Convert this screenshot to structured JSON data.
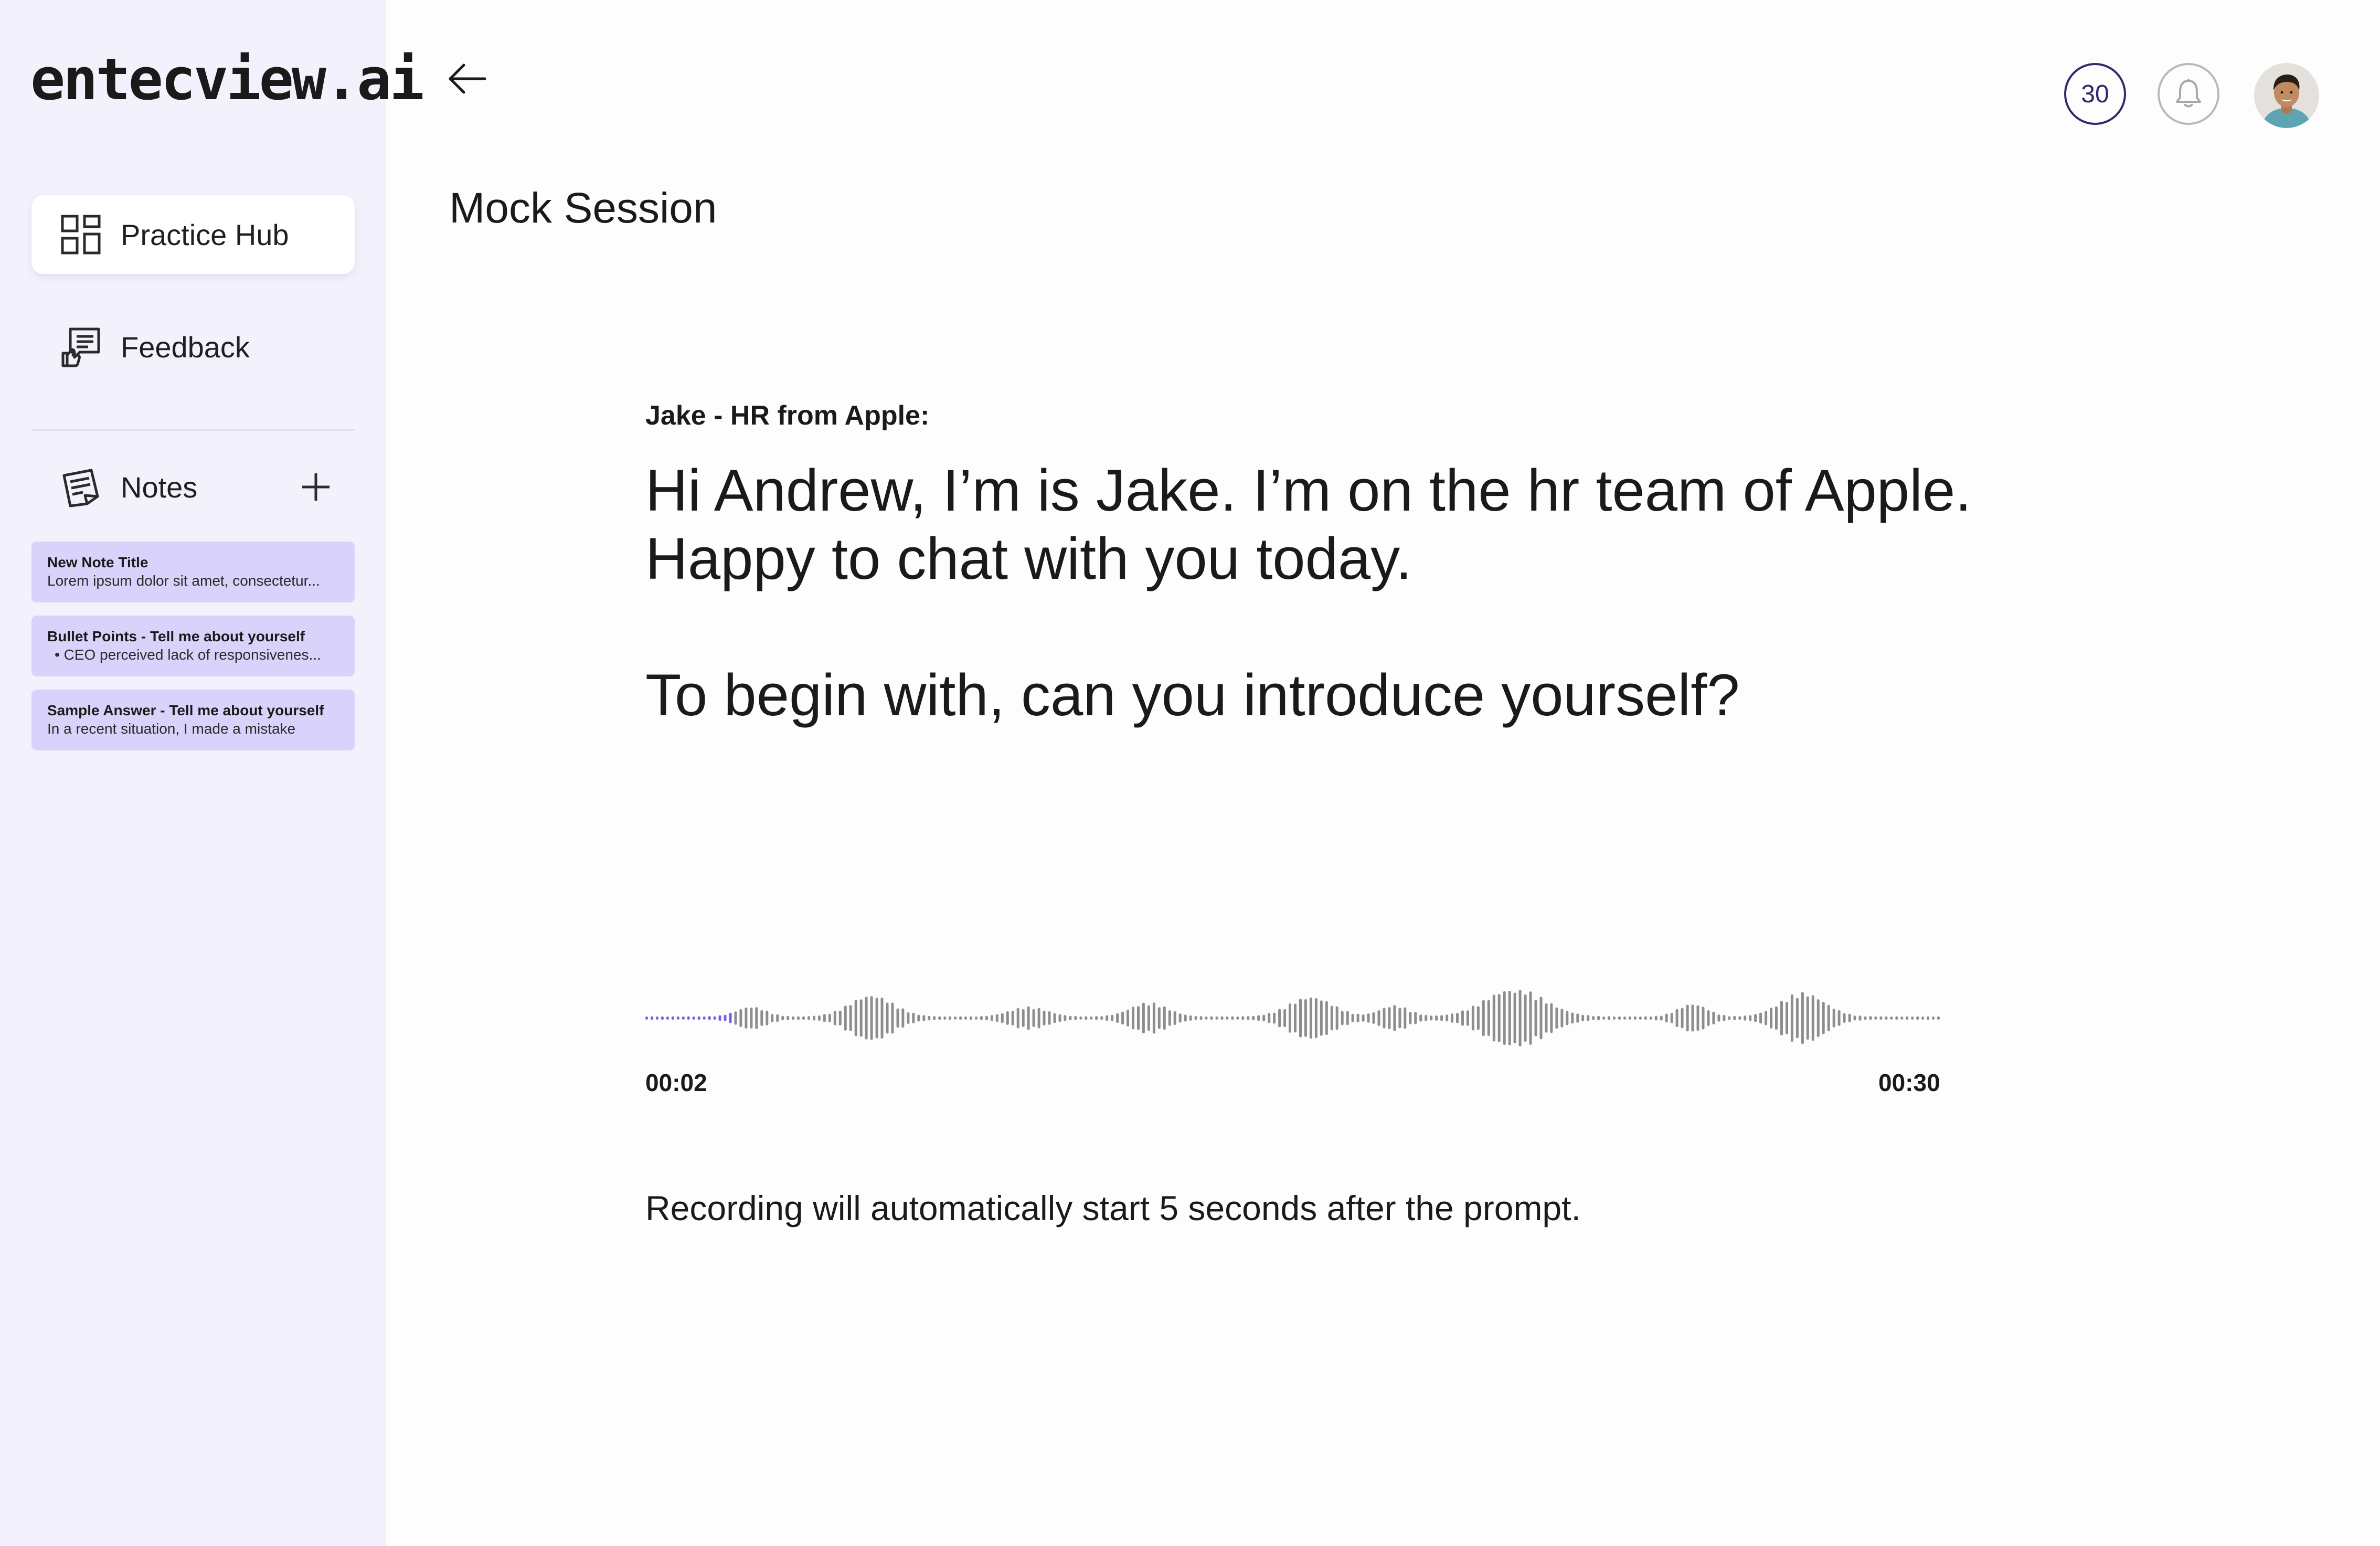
{
  "brand": {
    "logo_text": "entecview.ai"
  },
  "sidebar": {
    "nav": [
      {
        "label": "Practice Hub",
        "icon": "grid-icon",
        "active": true
      },
      {
        "label": "Feedback",
        "icon": "feedback-icon",
        "active": false
      }
    ],
    "notes": {
      "label": "Notes",
      "add_icon": "plus-icon",
      "items": [
        {
          "title": "New Note Title",
          "preview": "Lorem ipsum dolor sit amet, consectetur..."
        },
        {
          "title": "Bullet Points - Tell me about yourself",
          "preview": "•  CEO perceived lack of responsivenes..."
        },
        {
          "title": "Sample Answer - Tell me about yourself",
          "preview": "In a recent situation, I made a mistake"
        }
      ]
    }
  },
  "header": {
    "back_icon": "arrow-left-icon",
    "credits": "30",
    "bell_icon": "bell-icon",
    "avatar_icon": "user-avatar"
  },
  "main": {
    "title": "Mock Session",
    "speaker": "Jake - HR from Apple:",
    "prompt_lines": [
      "Hi Andrew, I’m is Jake. I’m on the hr team of Apple.",
      "Happy to chat with you today.",
      "To begin with, can you introduce yourself?"
    ],
    "audio": {
      "elapsed": "00:02",
      "duration": "00:30",
      "progress_fraction": 0.067,
      "played_color": "#7b5ce0",
      "unplayed_color": "#8d8d8d"
    },
    "hint": "Recording will automatically start 5 seconds after the prompt."
  }
}
